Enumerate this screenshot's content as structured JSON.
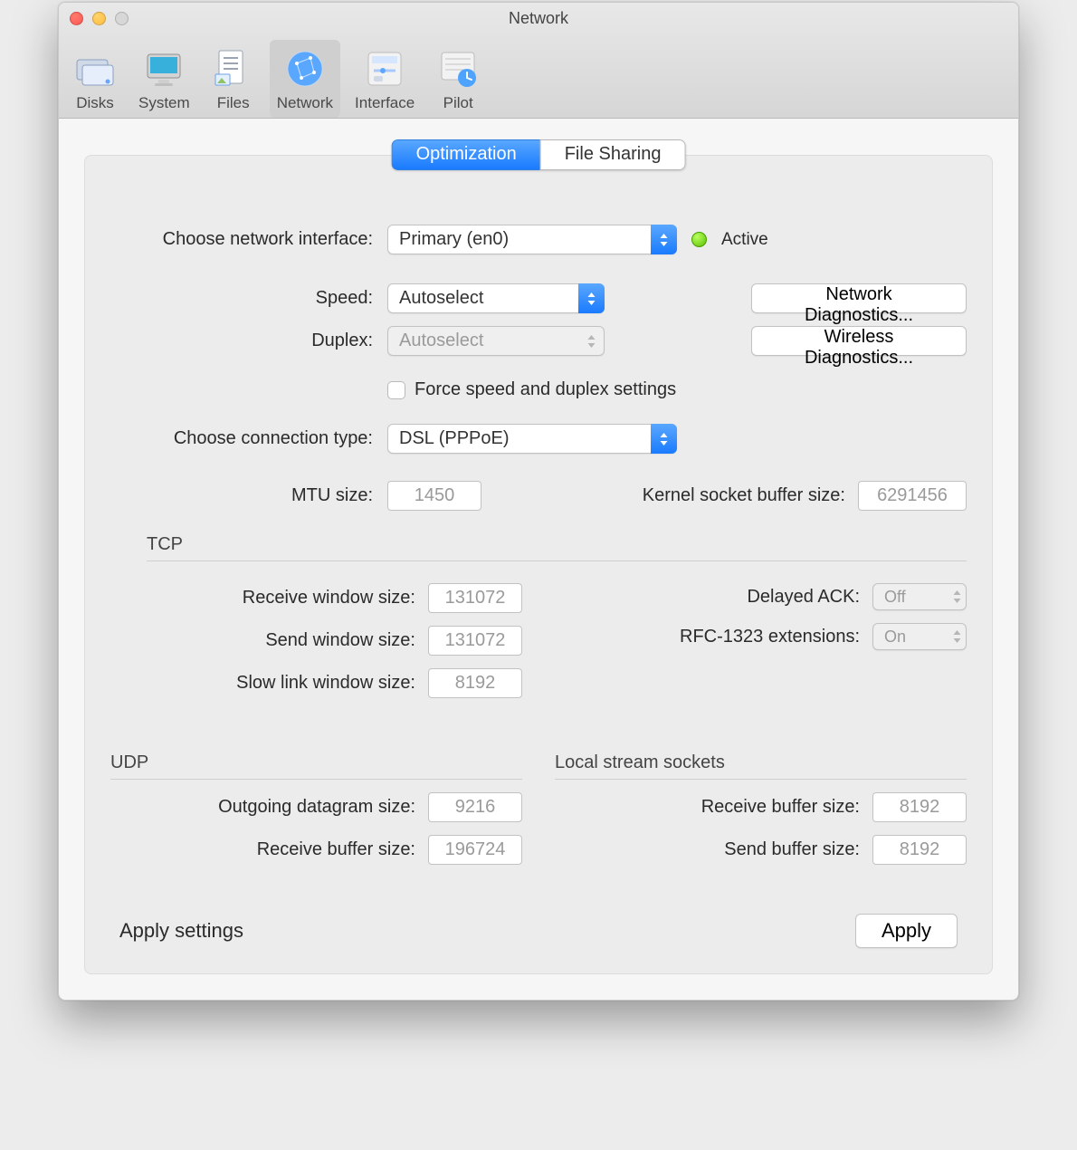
{
  "windowTitle": "Network",
  "toolbar": [
    {
      "label": "Disks"
    },
    {
      "label": "System"
    },
    {
      "label": "Files"
    },
    {
      "label": "Network"
    },
    {
      "label": "Interface"
    },
    {
      "label": "Pilot"
    }
  ],
  "tabs": {
    "optimization": "Optimization",
    "fileSharing": "File Sharing"
  },
  "labels": {
    "chooseInterface": "Choose network interface:",
    "active": "Active",
    "speed": "Speed:",
    "duplex": "Duplex:",
    "networkDiag": "Network Diagnostics...",
    "wirelessDiag": "Wireless Diagnostics...",
    "forceSpeed": "Force speed and duplex settings",
    "chooseConnType": "Choose connection type:",
    "mtu": "MTU size:",
    "kernelBuf": "Kernel socket buffer size:",
    "tcp": "TCP",
    "recvWin": "Receive window size:",
    "sendWin": "Send window size:",
    "slowLink": "Slow link window size:",
    "delayedAck": "Delayed ACK:",
    "rfc1323": "RFC-1323 extensions:",
    "udp": "UDP",
    "outgoingDg": "Outgoing datagram size:",
    "recvBuf": "Receive buffer size:",
    "localStream": "Local stream sockets",
    "lsRecvBuf": "Receive buffer size:",
    "lsSendBuf": "Send buffer size:",
    "applySettings": "Apply settings",
    "apply": "Apply"
  },
  "values": {
    "interface": "Primary (en0)",
    "speed": "Autoselect",
    "duplex": "Autoselect",
    "connType": "DSL (PPPoE)",
    "mtu": "1450",
    "kernelBuf": "6291456",
    "recvWin": "131072",
    "sendWin": "131072",
    "slowLink": "8192",
    "delayedAck": "Off",
    "rfc1323": "On",
    "outgoingDg": "9216",
    "udpRecvBuf": "196724",
    "lsRecvBuf": "8192",
    "lsSendBuf": "8192"
  }
}
